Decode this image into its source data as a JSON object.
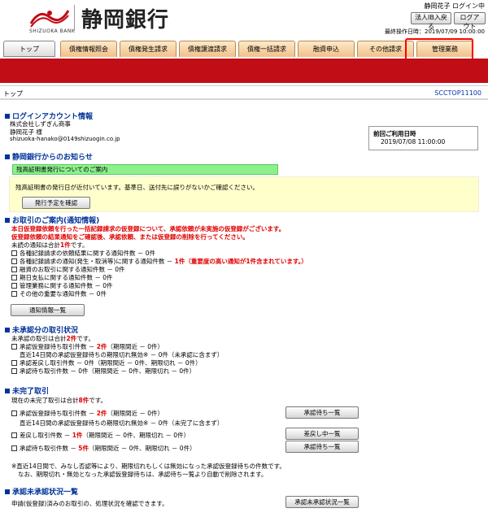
{
  "header": {
    "logo_sub": "SHIZUOKA BANK",
    "bank_name": "静岡銀行",
    "user": "静岡花子 ログイン中",
    "corp_button": "法人IB入戻る",
    "logout_button": "ログアウト",
    "last_op": "最終操作日時：2019/07/09 10:00:00"
  },
  "nav": [
    "トップ",
    "債権情報照会",
    "債権発生請求",
    "債権譲渡請求",
    "債権一括請求",
    "融資申込",
    "その他請求",
    "管理業務"
  ],
  "crumb": "トップ",
  "screen_id": "SCCTOP11100",
  "login_info": {
    "title": "ログインアカウント情報",
    "company": "株式会社しずぎん商事",
    "name": "静岡花子 様",
    "email": "shizuoka-hanako@0149shizuogin.co.jp",
    "last_login_label": "前回ご利用日時",
    "last_login_value": "2019/07/08 11:00:00"
  },
  "news": {
    "title": "静岡銀行からのお知らせ",
    "green": "残高証明書発行についてのご案内",
    "yellow": "残高証明書の発行日が近付いています。基準日、送付先に誤りがないかご確認ください。",
    "button": "発行予定を確認"
  },
  "transactions": {
    "title": "お取引のご案内(通知情報)",
    "alert1": "本日仮登録依頼を行った一括記録請求の仮登録について、承認依頼が未実施の仮登録がございます。",
    "alert2": "仮登録依頼の結果通知をご確認後、承認依頼、または仮登録の削除を行ってください。",
    "unread_prefix": "未読の通知は合計",
    "unread_count": "1件",
    "unread_suffix": "です。",
    "items": [
      {
        "label": "各種記録請求の依頼結果に関する通知件数 － 0件",
        "extra": ""
      },
      {
        "label": "各種記録請求の通知(発生・取消等)に関する通知件数 －",
        "extra": "1件（重要度の高い通知が1件含まれています。）"
      },
      {
        "label": "融資のお取引に関する通知件数 － 0件",
        "extra": ""
      },
      {
        "label": "期日支払に関する通知件数 － 0件",
        "extra": ""
      },
      {
        "label": "管理業務に関する通知件数 － 0件",
        "extra": ""
      },
      {
        "label": "その他の重要な通知件数 － 0件",
        "extra": ""
      }
    ],
    "button": "通知情報一覧"
  },
  "unapproved": {
    "title": "未承認分の取引状況",
    "summary_prefix": "未承認の取引は合計",
    "summary_count": "2件",
    "summary_suffix": "です。",
    "row1_label": "承認仮登録待ち取引件数 －",
    "row1_count": "2件",
    "row1_rest": "（期限間近 － 0件）",
    "row1_sub": "直近14日間の承認仮登録待ちの期限切れ無効※ － 0件（未承認に含まず）",
    "row2": "承認差戻し取引件数 － 0件（期限間近 － 0件、期限切れ － 0件）",
    "row3": "承認待ち取引件数 － 0件（期限間近 － 0件、期限切れ － 0件）"
  },
  "incomplete": {
    "title": "未完了取引",
    "summary_prefix": "現在の未完了取引は合計",
    "summary_count": "8件",
    "summary_suffix": "です。",
    "row1_label": "承認仮登録待ち取引件数 －",
    "row1_count": "2件",
    "row1_rest": "（期限間近 － 0件）",
    "row1_sub": "直近14日間の承認仮登録待ちの期限切れ無効※ － 0件（未完了に含まず）",
    "row2_label": "差戻し取引件数 －",
    "row2_count": "1件",
    "row2_rest": "（期限間近 － 0件、期限切れ － 0件）",
    "row3_label": "承認待ち取引件数 －",
    "row3_count": "5件",
    "row3_rest": "（期限間近 － 0件、期限切れ － 0件）",
    "btn1": "承認待ち一覧",
    "btn2": "差戻し中一覧",
    "btn3": "承認待ち一覧",
    "note1": "※直近14日間で、みなし否認等により、期限切れもしくは無効になった承認仮登録待ちの件数です。",
    "note2": "なお、期限切れ・無効となった承認仮登録待ちは、承認待ち一覧より自動で削除されます。"
  },
  "approval_status": {
    "title": "承認未承認状況一覧",
    "desc": "申請(仮登録)済みのお取引の、処理状況を確認できます。",
    "button": "承認未承認状況一覧"
  }
}
